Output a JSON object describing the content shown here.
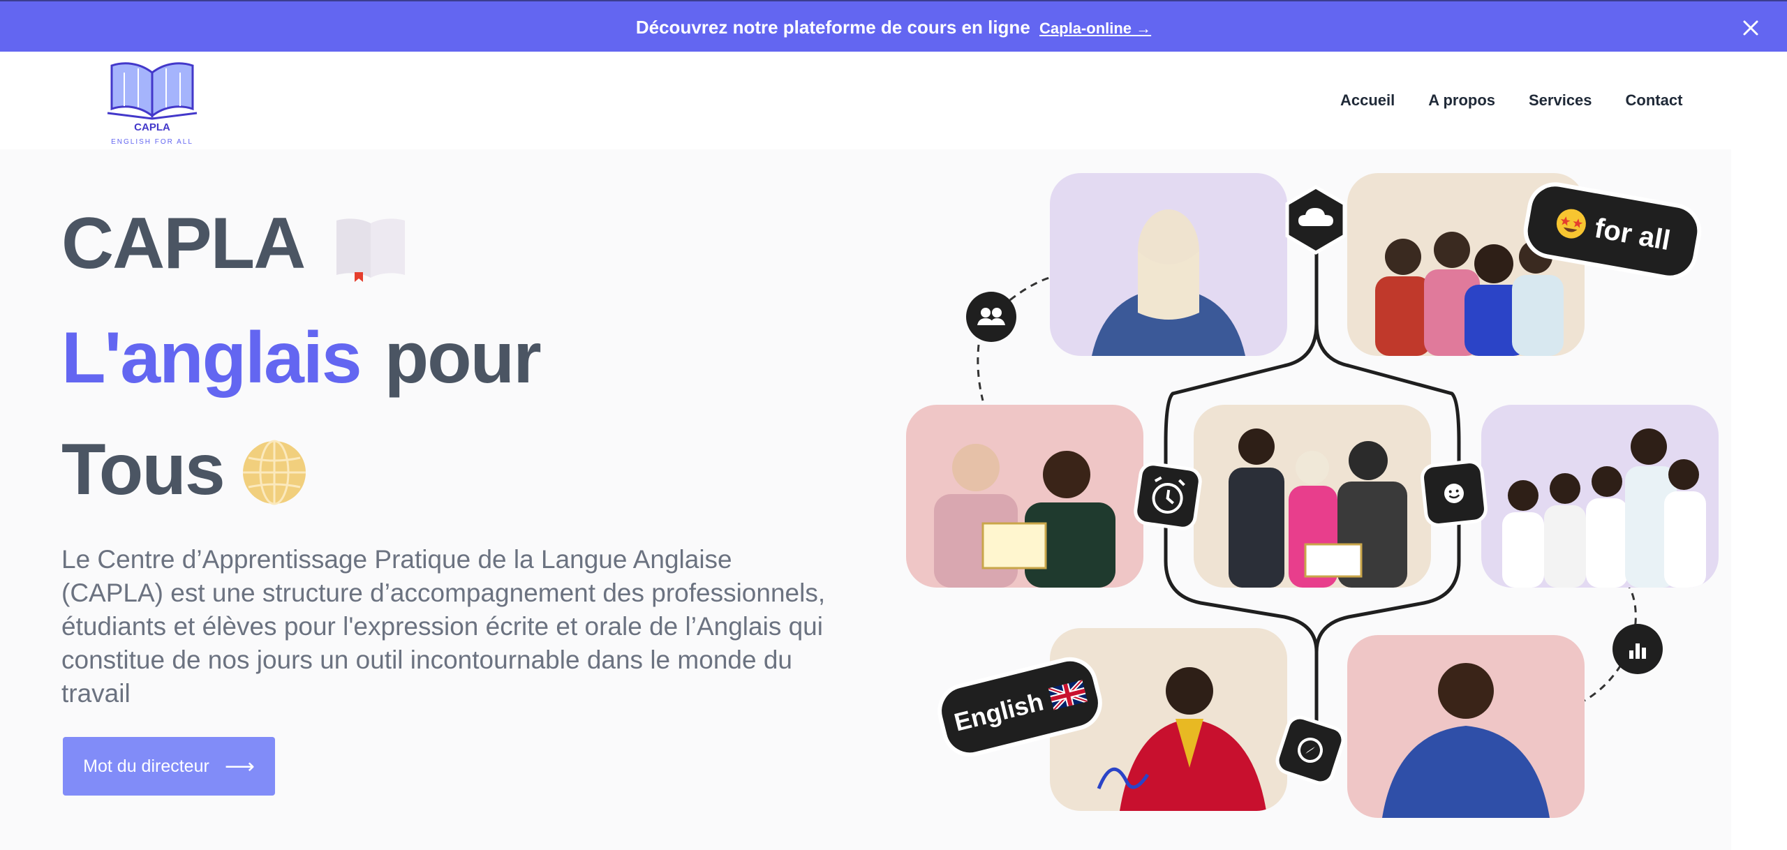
{
  "banner": {
    "text": "Découvrez notre plateforme de cours en ligne",
    "link_label": "Capla-online →"
  },
  "logo": {
    "title": "CAPLA",
    "subtitle": "ENGLISH FOR ALL"
  },
  "nav": {
    "items": [
      "Accueil",
      "A propos",
      "Services",
      "Contact"
    ]
  },
  "hero": {
    "line1": "CAPLA",
    "accent": "L'anglais",
    "line2_rest": "pour",
    "line3": "Tous",
    "description": "Le Centre d’Apprentissage Pratique de la Langue Anglaise (CAPLA) est une structure d’accompagnement des professionnels, étudiants et élèves pour l'expression écrite et orale de l’Anglais qui constitue de nos jours un outil incontournable dans le monde du travail",
    "cta_label": "Mot du directeur",
    "cta_arrow": "⟶"
  },
  "collage": {
    "pill_for_all": "for all",
    "pill_english": "English",
    "icons": [
      "cloud-icon",
      "users-icon",
      "alarm-clock-icon",
      "smile-icon",
      "bar-chart-icon",
      "compass-icon",
      "star-struck-emoji-icon",
      "uk-flag-icon"
    ]
  },
  "colors": {
    "accent": "#6366f1",
    "banner": "#6366f1",
    "button": "#818cf8",
    "heading": "#4b5563",
    "body_text": "#6b7280",
    "tile_lavender": "#e3daf2",
    "tile_beige": "#efe3d3",
    "tile_pink": "#efc6c6"
  }
}
